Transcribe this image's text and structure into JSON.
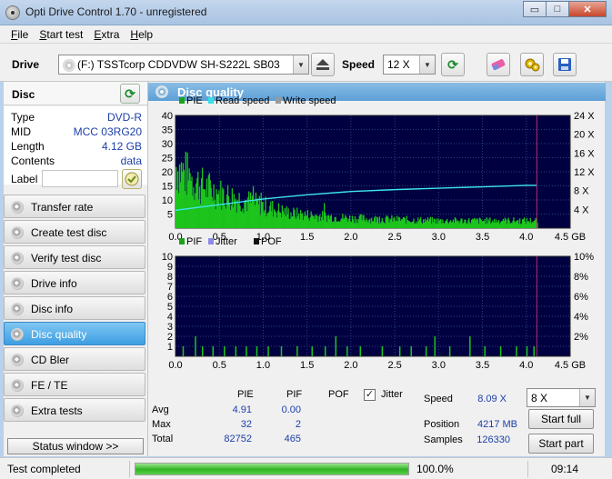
{
  "window": {
    "title": "Opti Drive Control 1.70 - unregistered",
    "min_glyph": "▭",
    "max_glyph": "□",
    "close_glyph": "✕"
  },
  "menu": [
    {
      "label": "File",
      "accel": "F"
    },
    {
      "label": "Start test",
      "accel": "S"
    },
    {
      "label": "Extra",
      "accel": "E"
    },
    {
      "label": "Help",
      "accel": "H"
    }
  ],
  "toolbar": {
    "drive_label": "Drive",
    "drive_value": "(F:)  TSSTcorp CDDVDW SH-S222L SB03",
    "speed_label": "Speed",
    "speed_value": "12 X"
  },
  "disc": {
    "header": "Disc",
    "rows": [
      {
        "k": "Type",
        "v": "DVD-R"
      },
      {
        "k": "MID",
        "v": "MCC 03RG20"
      },
      {
        "k": "Length",
        "v": "4.12 GB"
      },
      {
        "k": "Contents",
        "v": "data"
      }
    ],
    "label_key": "Label",
    "label_value": ""
  },
  "nav": [
    {
      "label": "Transfer rate",
      "active": false
    },
    {
      "label": "Create test disc",
      "active": false
    },
    {
      "label": "Verify test disc",
      "active": false
    },
    {
      "label": "Drive info",
      "active": false
    },
    {
      "label": "Disc info",
      "active": false
    },
    {
      "label": "Disc quality",
      "active": true
    },
    {
      "label": "CD Bler",
      "active": false
    },
    {
      "label": "FE / TE",
      "active": false
    },
    {
      "label": "Extra tests",
      "active": false
    }
  ],
  "status_window_label": "Status window >>",
  "main": {
    "title": "Disc quality"
  },
  "chart_data": [
    {
      "type": "bar",
      "legend": [
        {
          "name": "PIE",
          "color": "#18a418"
        },
        {
          "name": "Read speed",
          "color": "#33e0e8"
        },
        {
          "name": "Write speed",
          "color": "#9a9a9a"
        }
      ],
      "x_ticks": [
        "0.0",
        "0.5",
        "1.0",
        "1.5",
        "2.0",
        "2.5",
        "3.0",
        "3.5",
        "4.0",
        "4.5 GB"
      ],
      "x_range": [
        0,
        4.5
      ],
      "y_ticks": [
        "5",
        "10",
        "15",
        "20",
        "25",
        "30",
        "35",
        "40"
      ],
      "y_range": [
        0,
        40
      ],
      "y2_ticks": [
        "4 X",
        "8 X",
        "12 X",
        "16 X",
        "20 X",
        "24 X"
      ],
      "y2_range": [
        0,
        24
      ],
      "disc_end_gb": 4.12,
      "pie_profile": [
        [
          0.0,
          25
        ],
        [
          0.1,
          22
        ],
        [
          0.3,
          17
        ],
        [
          0.5,
          14
        ],
        [
          0.8,
          11
        ],
        [
          1.0,
          9
        ],
        [
          1.3,
          6
        ],
        [
          1.6,
          5
        ],
        [
          2.0,
          4
        ],
        [
          2.5,
          3.5
        ],
        [
          3.0,
          3
        ],
        [
          3.5,
          3
        ],
        [
          4.0,
          3
        ],
        [
          4.12,
          3
        ]
      ],
      "read_speed": [
        [
          0.0,
          3.8
        ],
        [
          0.5,
          5.0
        ],
        [
          1.0,
          6.2
        ],
        [
          1.5,
          7.1
        ],
        [
          2.0,
          7.8
        ],
        [
          2.5,
          8.2
        ],
        [
          3.0,
          8.5
        ],
        [
          3.5,
          8.8
        ],
        [
          4.0,
          9.1
        ],
        [
          4.12,
          9.1
        ]
      ]
    },
    {
      "type": "bar",
      "legend": [
        {
          "name": "PIF",
          "color": "#18a418"
        },
        {
          "name": "Jitter",
          "color": "#8b8be6"
        },
        {
          "name": "POF",
          "color": "#111111"
        }
      ],
      "x_ticks": [
        "0.0",
        "0.5",
        "1.0",
        "1.5",
        "2.0",
        "2.5",
        "3.0",
        "3.5",
        "4.0",
        "4.5 GB"
      ],
      "x_range": [
        0,
        4.5
      ],
      "y_ticks": [
        "1",
        "2",
        "3",
        "4",
        "5",
        "6",
        "7",
        "8",
        "9",
        "10"
      ],
      "y_range": [
        0,
        10
      ],
      "y2_ticks": [
        "2%",
        "4%",
        "6%",
        "8%",
        "10%"
      ],
      "y2_range": [
        0,
        10
      ],
      "disc_end_gb": 4.12,
      "pif_spikes": [
        [
          0.08,
          1
        ],
        [
          0.22,
          2
        ],
        [
          0.3,
          1
        ],
        [
          0.42,
          1
        ],
        [
          0.55,
          1
        ],
        [
          0.68,
          1
        ],
        [
          0.8,
          1
        ],
        [
          0.92,
          1
        ],
        [
          1.05,
          1
        ],
        [
          1.2,
          1
        ],
        [
          1.38,
          1
        ],
        [
          1.55,
          1
        ],
        [
          1.7,
          1
        ],
        [
          1.82,
          2
        ],
        [
          1.95,
          1
        ],
        [
          2.1,
          1
        ],
        [
          2.35,
          1
        ],
        [
          2.55,
          1
        ],
        [
          2.68,
          1
        ],
        [
          2.85,
          1
        ],
        [
          2.95,
          2
        ],
        [
          3.12,
          1
        ],
        [
          3.35,
          2
        ],
        [
          3.52,
          1
        ],
        [
          3.7,
          1
        ],
        [
          3.88,
          1
        ],
        [
          4.0,
          1
        ],
        [
          4.08,
          1
        ]
      ]
    }
  ],
  "stats": {
    "headers": {
      "pie": "PIE",
      "pif": "PIF",
      "pof": "POF",
      "jitter": "Jitter"
    },
    "jitter_checked": true,
    "rows": [
      {
        "label": "Avg",
        "pie": "4.91",
        "pif": "0.00"
      },
      {
        "label": "Max",
        "pie": "32",
        "pif": "2"
      },
      {
        "label": "Total",
        "pie": "82752",
        "pif": "465"
      }
    ],
    "speed_label": "Speed",
    "speed_value": "8.09 X",
    "speed_select": "8 X",
    "position_label": "Position",
    "position_value": "4217 MB",
    "samples_label": "Samples",
    "samples_value": "126330",
    "start_full": "Start full",
    "start_part": "Start part"
  },
  "status": {
    "text": "Test completed",
    "progress": 1.0,
    "percent": "100.0%",
    "time": "09:14"
  }
}
